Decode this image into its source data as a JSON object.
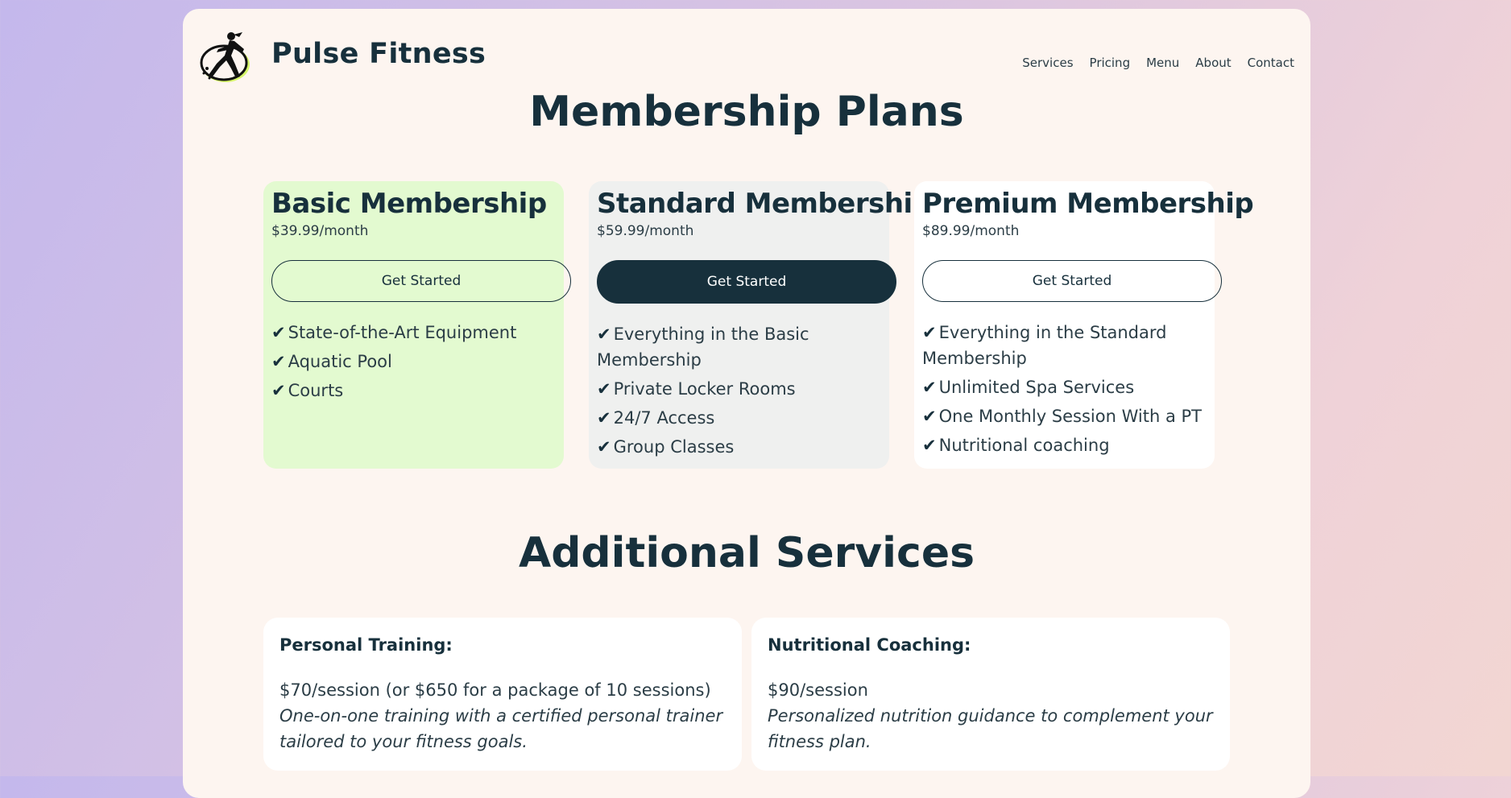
{
  "header": {
    "brand": "Pulse Fitness",
    "nav": [
      "Services",
      "Pricing",
      "Menu",
      "About",
      "Contact"
    ]
  },
  "membership": {
    "title": "Membership Plans",
    "plans": [
      {
        "name": "Basic Membership",
        "price": "$39.99/month",
        "button": "Get Started",
        "features": [
          "State-of-the-Art Equipment",
          "Aquatic Pool",
          "Courts"
        ]
      },
      {
        "name": "Standard Membership",
        "price": "$59.99/month",
        "button": "Get Started",
        "features": [
          "Everything in the Basic Membership",
          "Private Locker Rooms",
          "24/7 Access",
          "Group Classes"
        ]
      },
      {
        "name": "Premium Membership",
        "price": "$89.99/month",
        "button": "Get Started",
        "features": [
          "Everything in the Standard Membership",
          "Unlimited Spa Services",
          "One Monthly Session With a PT",
          "Nutritional coaching"
        ]
      }
    ]
  },
  "services": {
    "title": "Additional Services",
    "items": [
      {
        "name": "Personal Training:",
        "price": "$70/session (or $650 for a package of 10 sessions)",
        "description": "One-on-one training with a certified personal trainer tailored to your fitness goals."
      },
      {
        "name": "Nutritional Coaching:",
        "price": "$90/session",
        "description": "Personalized nutrition guidance to complement your fitness plan."
      }
    ]
  },
  "check_symbol": "✔",
  "colors": {
    "text": "#17303c",
    "basic_card": "#e3fad0",
    "standard_card": "#eff0ef",
    "premium_card": "#ffffff",
    "logo_accent": "#d6f56a"
  }
}
